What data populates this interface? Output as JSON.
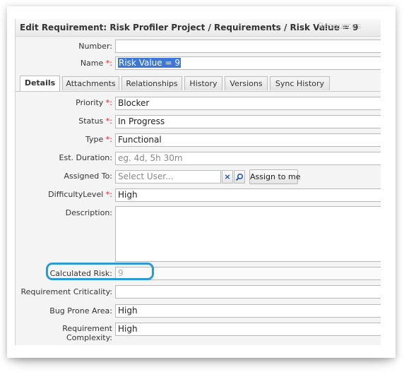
{
  "dialog": {
    "title": "Edit Requirement: Risk Profiler Project / Requirements / Risk Value = 9",
    "background_text": "Resources"
  },
  "fields": {
    "number": {
      "label": "Number:",
      "value": ""
    },
    "name": {
      "label": "Name",
      "required_marker": "*:",
      "value": "Risk Value = 9"
    }
  },
  "tabs": [
    "Details",
    "Attachments",
    "Relationships",
    "History",
    "Versions",
    "Sync History"
  ],
  "active_tab": "Details",
  "details": {
    "priority": {
      "label": "Priority",
      "required_marker": "*:",
      "value": "Blocker"
    },
    "status": {
      "label": "Status",
      "required_marker": "*:",
      "value": "In Progress"
    },
    "type": {
      "label": "Type",
      "required_marker": "*:",
      "value": "Functional"
    },
    "est_duration": {
      "label": "Est. Duration:",
      "placeholder": "eg. 4d, 5h 30m"
    },
    "assigned_to": {
      "label": "Assigned To:",
      "placeholder": "Select User...",
      "clear_icon": "×",
      "assign_button": "Assign to me"
    },
    "difficulty": {
      "label": "DifficultyLevel",
      "required_marker": "*:",
      "value": "High"
    },
    "description": {
      "label": "Description:",
      "value": ""
    },
    "calculated_risk": {
      "label": "Calculated Risk:",
      "value": "9"
    },
    "criticality": {
      "label": "Requirement Criticality:",
      "value": ""
    },
    "bug_prone": {
      "label": "Bug Prone Area:",
      "value": "High"
    },
    "complexity": {
      "label_line1": "Requirement",
      "label_line2": "Complexity:",
      "value": "High"
    }
  },
  "colors": {
    "highlight": "#2c9bcd",
    "required": "#dd2222",
    "selection": "#3c77d8"
  }
}
